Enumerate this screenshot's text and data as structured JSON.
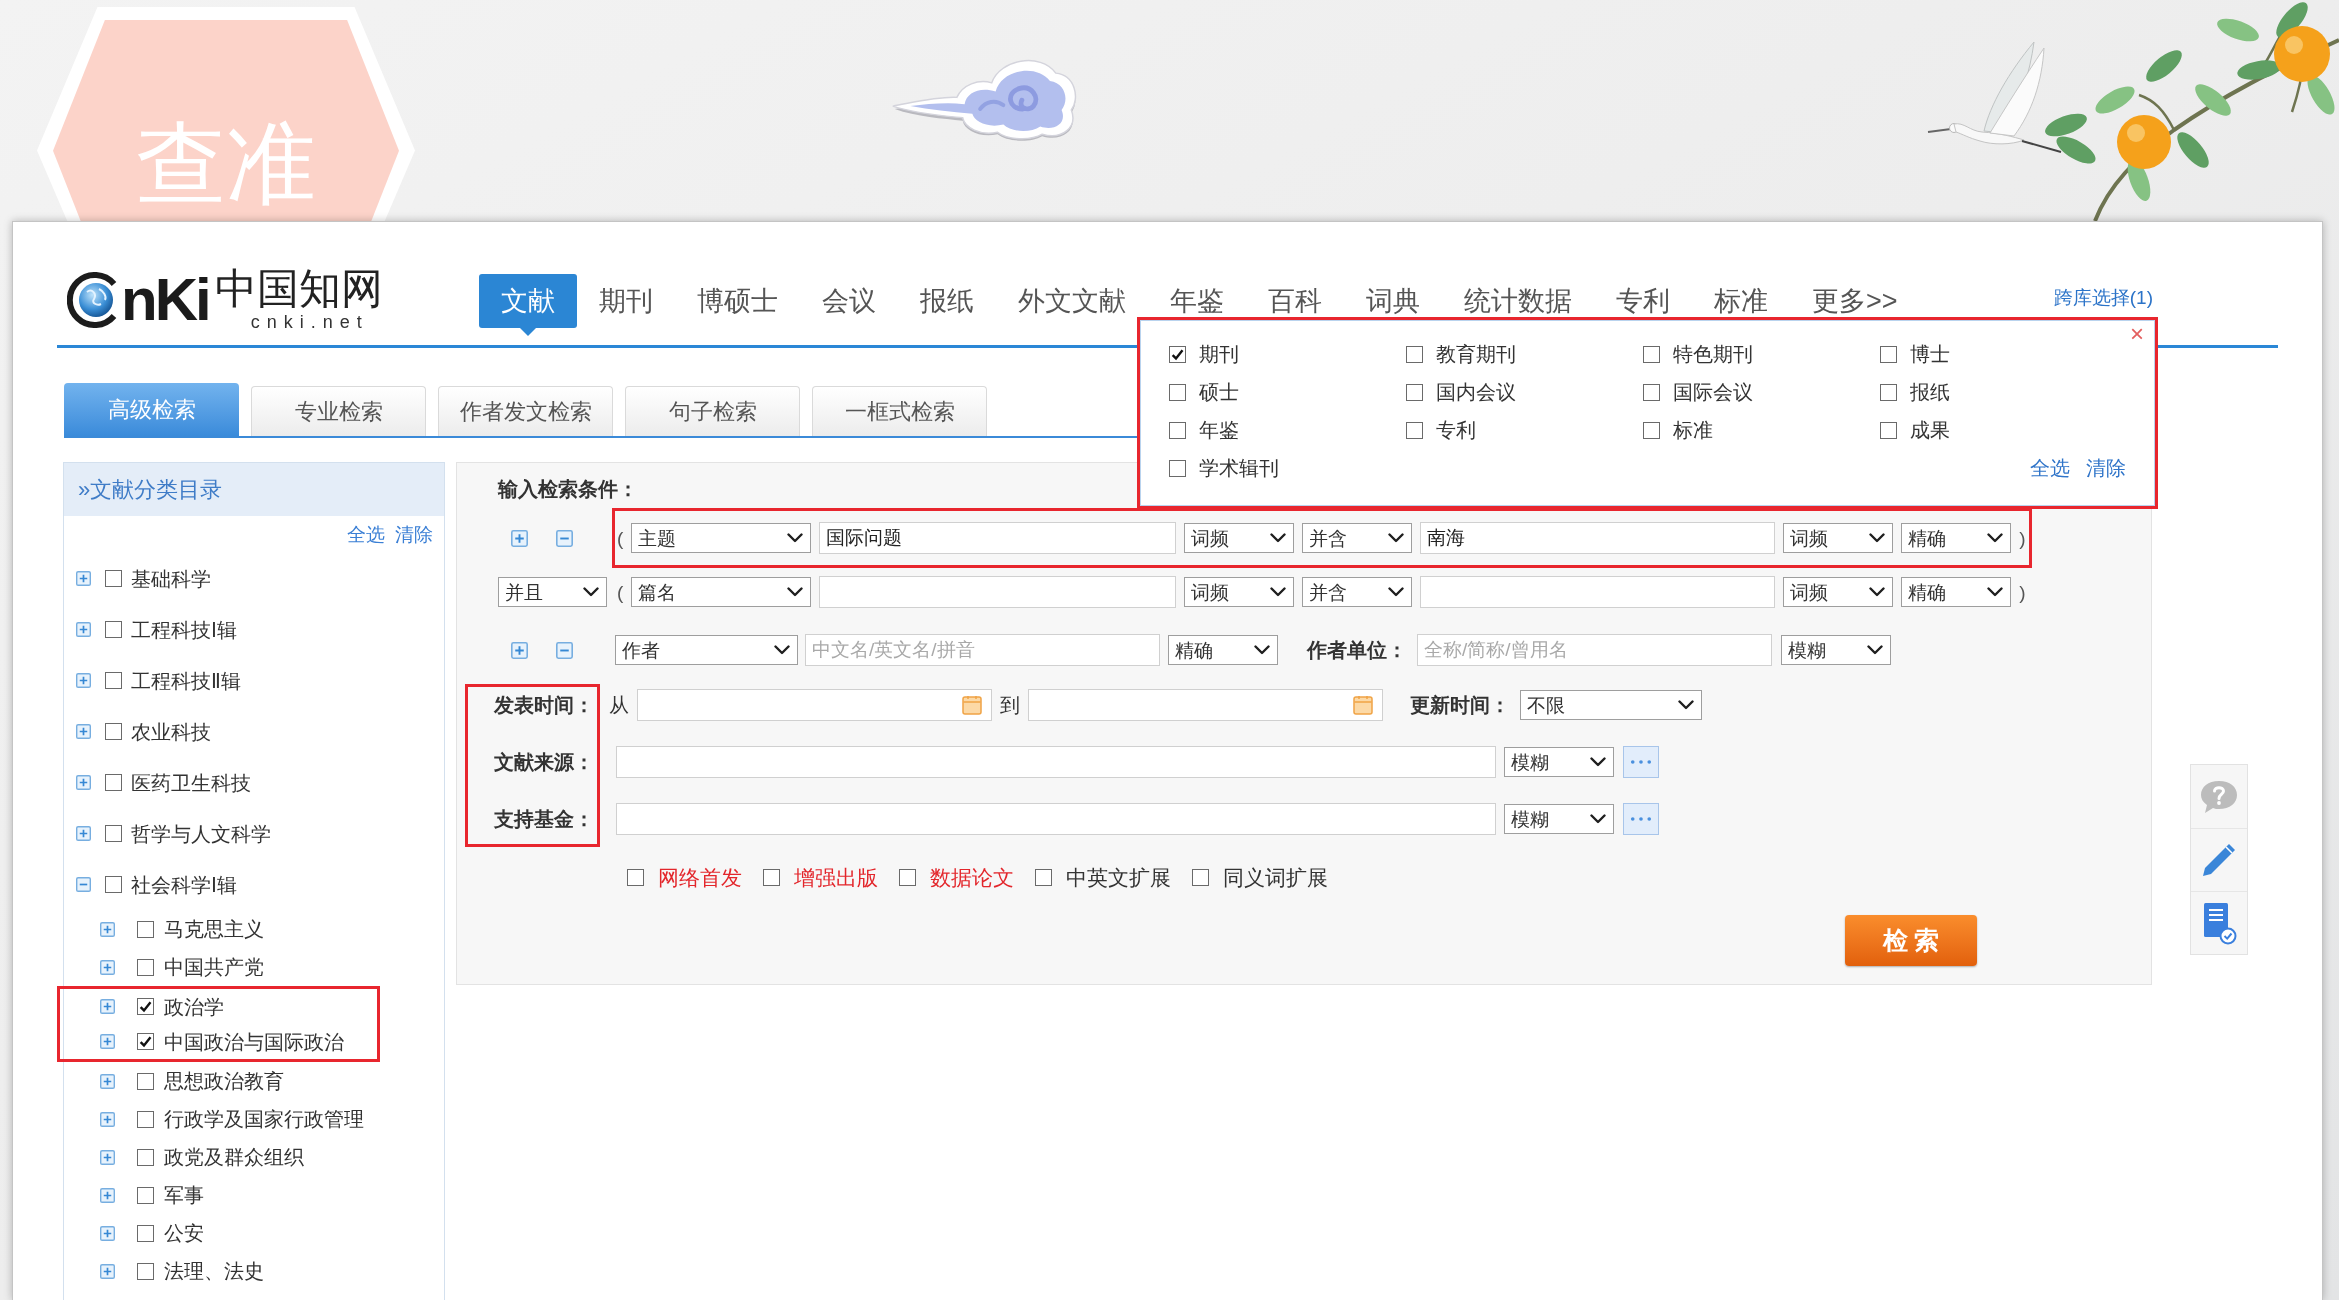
{
  "badge": {
    "text": "查准"
  },
  "logo": {
    "wordmark": "nKi",
    "name": "中国知网",
    "domain": "cnki.net"
  },
  "nav": {
    "tabs": [
      {
        "label": "文献",
        "selected": true
      },
      {
        "label": "期刊",
        "selected": false
      },
      {
        "label": "博硕士",
        "selected": false
      },
      {
        "label": "会议",
        "selected": false
      },
      {
        "label": "报纸",
        "selected": false
      },
      {
        "label": "外文文献",
        "selected": false
      },
      {
        "label": "年鉴",
        "selected": false
      },
      {
        "label": "百科",
        "selected": false
      },
      {
        "label": "词典",
        "selected": false
      },
      {
        "label": "统计数据",
        "selected": false
      },
      {
        "label": "专利",
        "selected": false
      },
      {
        "label": "标准",
        "selected": false
      },
      {
        "label": "更多>>",
        "selected": false
      }
    ],
    "database_link": "跨库选择(1)"
  },
  "search_tabs": [
    {
      "label": "高级检索",
      "selected": true
    },
    {
      "label": "专业检索",
      "selected": false
    },
    {
      "label": "作者发文检索",
      "selected": false
    },
    {
      "label": "句子检索",
      "selected": false
    },
    {
      "label": "一框式检索",
      "selected": false
    }
  ],
  "database_panel": {
    "highlighted": true,
    "close": "×",
    "options": [
      {
        "label": "期刊",
        "checked": true
      },
      {
        "label": "教育期刊",
        "checked": false
      },
      {
        "label": "特色期刊",
        "checked": false
      },
      {
        "label": "博士",
        "checked": false
      },
      {
        "label": "硕士",
        "checked": false
      },
      {
        "label": "国内会议",
        "checked": false
      },
      {
        "label": "国际会议",
        "checked": false
      },
      {
        "label": "报纸",
        "checked": false
      },
      {
        "label": "年鉴",
        "checked": false
      },
      {
        "label": "专利",
        "checked": false
      },
      {
        "label": "标准",
        "checked": false
      },
      {
        "label": "成果",
        "checked": false
      },
      {
        "label": "学术辑刊",
        "checked": false
      }
    ],
    "actions": [
      "全选",
      "清除"
    ]
  },
  "sidebar": {
    "title": "»文献分类目录",
    "actions": [
      "全选",
      "清除"
    ],
    "items": [
      {
        "label": "基础科学",
        "checked": false,
        "expanded": false,
        "highlighted": false
      },
      {
        "label": "工程科技Ⅰ辑",
        "checked": false,
        "expanded": false,
        "highlighted": false
      },
      {
        "label": "工程科技Ⅱ辑",
        "checked": false,
        "expanded": false,
        "highlighted": false
      },
      {
        "label": "农业科技",
        "checked": false,
        "expanded": false,
        "highlighted": false
      },
      {
        "label": "医药卫生科技",
        "checked": false,
        "expanded": false,
        "highlighted": false
      },
      {
        "label": "哲学与人文科学",
        "checked": false,
        "expanded": false,
        "highlighted": false
      },
      {
        "label": "社会科学Ⅰ辑",
        "checked": false,
        "expanded": true,
        "highlighted": false,
        "children": [
          {
            "label": "马克思主义",
            "checked": false,
            "expanded": false,
            "highlighted": false
          },
          {
            "label": "中国共产党",
            "checked": false,
            "expanded": false,
            "highlighted": false
          },
          {
            "label": "政治学",
            "checked": true,
            "expanded": false,
            "highlighted": true
          },
          {
            "label": "中国政治与国际政治",
            "checked": true,
            "expanded": false,
            "highlighted": true
          },
          {
            "label": "思想政治教育",
            "checked": false,
            "expanded": false,
            "highlighted": false
          },
          {
            "label": "行政学及国家行政管理",
            "checked": false,
            "expanded": false,
            "highlighted": false
          },
          {
            "label": "政党及群众组织",
            "checked": false,
            "expanded": false,
            "highlighted": false
          },
          {
            "label": "军事",
            "checked": false,
            "expanded": false,
            "highlighted": false
          },
          {
            "label": "公安",
            "checked": false,
            "expanded": false,
            "highlighted": false
          },
          {
            "label": "法理、法史",
            "checked": false,
            "expanded": false,
            "highlighted": false
          }
        ]
      }
    ]
  },
  "form": {
    "title": "输入检索条件：",
    "conditions": [
      {
        "kind": "first",
        "highlighted": true,
        "open": "(",
        "field": "主题",
        "value": "国际问题",
        "frequency": "词频",
        "combine": "并含",
        "value2": "南海",
        "frequency2": "词频",
        "match": "精确",
        "close": ")"
      },
      {
        "kind": "joined",
        "highlighted": false,
        "logic": "并且",
        "open": "(",
        "field": "篇名",
        "frequency": "词频",
        "combine": "并含",
        "frequency2": "词频",
        "match": "精确",
        "close": ")"
      }
    ],
    "author": {
      "field": "作者",
      "placeholder": "中文名/英文名/拼音",
      "match": "精确",
      "org_label": "作者单位：",
      "org_placeholder": "全称/简称/曾用名",
      "org_match": "模糊"
    },
    "filters": {
      "highlighted": true,
      "rows": [
        {
          "kind": "date",
          "label": "发表时间：",
          "from": "从",
          "to": "到",
          "update_label": "更新时间：",
          "update_value": "不限"
        },
        {
          "kind": "source",
          "label": "文献来源：",
          "match": "模糊"
        },
        {
          "kind": "source",
          "label": "支持基金：",
          "match": "模糊"
        }
      ]
    },
    "options": [
      {
        "label": "网络首发",
        "checked": false,
        "color": "#e3262b"
      },
      {
        "label": "增强出版",
        "checked": false,
        "color": "#e3262b"
      },
      {
        "label": "数据论文",
        "checked": false,
        "color": "#e3262b"
      },
      {
        "label": "中英文扩展",
        "checked": false,
        "color": "#333333"
      },
      {
        "label": "同义词扩展",
        "checked": false,
        "color": "#333333"
      }
    ],
    "search_button": "检 索"
  }
}
